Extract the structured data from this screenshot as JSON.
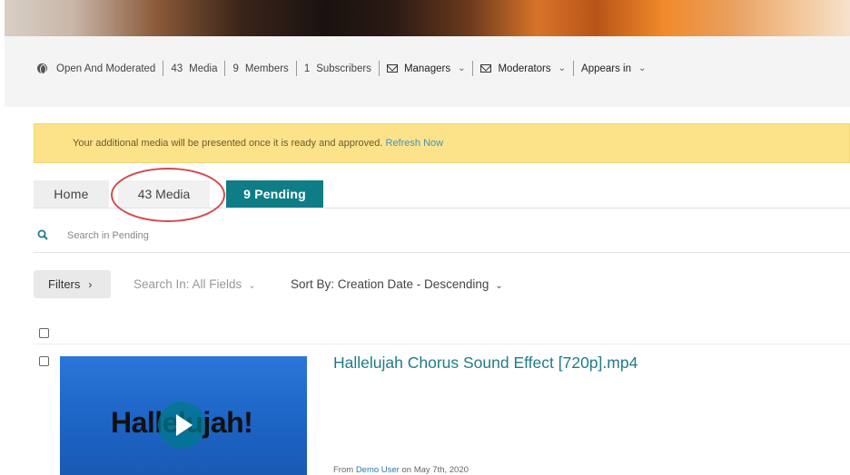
{
  "info": {
    "access": "Open And Moderated",
    "media_count": "43",
    "media_label": "Media",
    "members_count": "9",
    "members_label": "Members",
    "subscribers_count": "1",
    "subscribers_label": "Subscribers",
    "managers_label": "Managers",
    "moderators_label": "Moderators",
    "appears_in_label": "Appears in"
  },
  "alert": {
    "message": "Your additional media will be presented once it is ready and approved.",
    "link": "Refresh Now"
  },
  "tabs": [
    {
      "label": "Home"
    },
    {
      "label": "43 Media"
    },
    {
      "label": "9 Pending"
    }
  ],
  "search": {
    "placeholder": "Search in Pending"
  },
  "toolbar": {
    "filters_label": "Filters",
    "search_in": "Search In: All Fields",
    "sort_by": "Sort By: Creation Date - Descending"
  },
  "media": [
    {
      "title": "Hallelujah Chorus Sound Effect [720p].mp4",
      "thumb_text": "Hallelujah!",
      "from_label": "From",
      "user": "Demo User",
      "date_text": "on May 7th, 2020"
    }
  ],
  "colors": {
    "accent": "#0f7d86",
    "alert_bg": "#fce38a",
    "annotation": "#d44a4a"
  }
}
